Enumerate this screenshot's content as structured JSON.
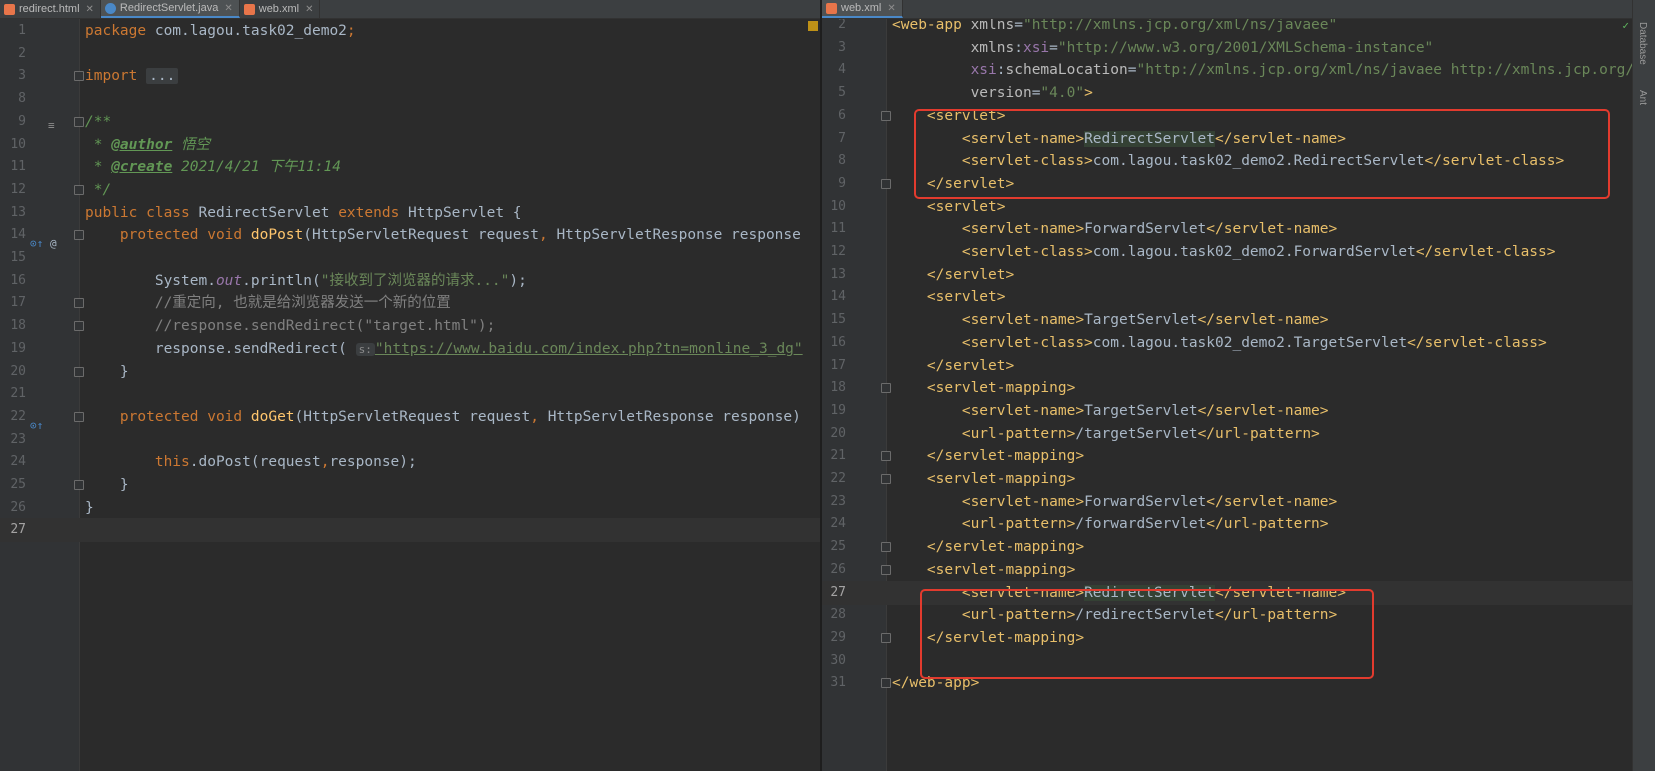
{
  "left_tabs": [
    {
      "label": "redirect.html",
      "icon": "html-file-icon",
      "color": "#e8754a"
    },
    {
      "label": "RedirectServlet.java",
      "icon": "java-class-icon",
      "color": "#4a88c7"
    },
    {
      "label": "web.xml",
      "icon": "xml-file-icon",
      "color": "#e8754a"
    }
  ],
  "right_tabs": [
    {
      "label": "web.xml",
      "icon": "xml-file-icon",
      "color": "#e8754a"
    }
  ],
  "right_strip_labels": [
    "Database",
    "Ant"
  ],
  "java_lines": [
    {
      "n": "1",
      "segs": [
        [
          "kw",
          "package "
        ],
        [
          "",
          "com.lagou.task02_demo2"
        ],
        [
          "kw",
          ";"
        ]
      ]
    },
    {
      "n": "2",
      "segs": []
    },
    {
      "n": "3",
      "segs": [
        [
          "kw",
          "import "
        ],
        [
          "fold-ell",
          "..."
        ]
      ]
    },
    {
      "n": "8",
      "segs": []
    },
    {
      "n": "9",
      "segs": [
        [
          "doc",
          "/**"
        ]
      ]
    },
    {
      "n": "10",
      "segs": [
        [
          "doc",
          " * "
        ],
        [
          "doctag",
          "@author"
        ],
        [
          "doc",
          " 悟空"
        ]
      ]
    },
    {
      "n": "11",
      "segs": [
        [
          "doc",
          " * "
        ],
        [
          "doctag",
          "@create"
        ],
        [
          "doc",
          " 2021/4/21 下午11:14"
        ]
      ]
    },
    {
      "n": "12",
      "segs": [
        [
          "doc",
          " */"
        ]
      ]
    },
    {
      "n": "13",
      "segs": [
        [
          "kw",
          "public class "
        ],
        [
          "",
          "RedirectServlet "
        ],
        [
          "kw",
          "extends "
        ],
        [
          "",
          "HttpServlet {"
        ]
      ]
    },
    {
      "n": "14",
      "segs": [
        [
          "",
          "    "
        ],
        [
          "kw",
          "protected void "
        ],
        [
          "method",
          "doPost"
        ],
        [
          "",
          "(HttpServletRequest request"
        ],
        [
          "kw",
          ", "
        ],
        [
          "",
          "HttpServletResponse response"
        ]
      ]
    },
    {
      "n": "15",
      "segs": []
    },
    {
      "n": "16",
      "segs": [
        [
          "",
          "        System."
        ],
        [
          "static",
          "out"
        ],
        [
          "",
          ".println("
        ],
        [
          "str",
          "\"接收到了浏览器的请求...\""
        ],
        [
          "",
          ");"
        ]
      ]
    },
    {
      "n": "17",
      "segs": [
        [
          "",
          "        "
        ],
        [
          "com",
          "//重定向, 也就是给浏览器发送一个新的位置"
        ]
      ]
    },
    {
      "n": "18",
      "segs": [
        [
          "",
          "        "
        ],
        [
          "com",
          "//response.sendRedirect(\"target.html\");"
        ]
      ]
    },
    {
      "n": "19",
      "segs": [
        [
          "",
          "        response.sendRedirect( "
        ],
        [
          "hint",
          "s:"
        ],
        [
          "",
          ""
        ],
        [
          "link",
          "\"https://www.baidu.com/index.php?tn=monline_3_dg\""
        ]
      ]
    },
    {
      "n": "20",
      "segs": [
        [
          "",
          "    }"
        ]
      ]
    },
    {
      "n": "21",
      "segs": []
    },
    {
      "n": "22",
      "segs": [
        [
          "",
          "    "
        ],
        [
          "kw",
          "protected void "
        ],
        [
          "method",
          "doGet"
        ],
        [
          "",
          "(HttpServletRequest request"
        ],
        [
          "kw",
          ", "
        ],
        [
          "",
          "HttpServletResponse response)"
        ]
      ]
    },
    {
      "n": "23",
      "segs": []
    },
    {
      "n": "24",
      "segs": [
        [
          "",
          "        "
        ],
        [
          "kw",
          "this"
        ],
        [
          "",
          ".doPost(request"
        ],
        [
          "kw",
          ","
        ],
        [
          "",
          "response);"
        ]
      ]
    },
    {
      "n": "25",
      "segs": [
        [
          "",
          "    }"
        ]
      ]
    },
    {
      "n": "26",
      "segs": [
        [
          "",
          "}"
        ]
      ]
    },
    {
      "n": "27",
      "segs": []
    }
  ],
  "xml_lines": [
    {
      "n": "2",
      "segs": [
        [
          "tag",
          "<web-app "
        ],
        [
          "attr",
          "xmlns"
        ],
        [
          "",
          "="
        ],
        [
          "str",
          "\"http://xmlns.jcp.org/xml/ns/javaee\""
        ]
      ]
    },
    {
      "n": "3",
      "segs": [
        [
          "",
          "         "
        ],
        [
          "attr",
          "xmlns"
        ],
        [
          "",
          ":"
        ],
        [
          "ns",
          "xsi"
        ],
        [
          "",
          "="
        ],
        [
          "str",
          "\"http://www.w3.org/2001/XMLSchema-instance\""
        ]
      ]
    },
    {
      "n": "4",
      "segs": [
        [
          "",
          "         "
        ],
        [
          "ns",
          "xsi"
        ],
        [
          "",
          ":"
        ],
        [
          "attr",
          "schemaLocation"
        ],
        [
          "",
          "="
        ],
        [
          "str",
          "\"http://xmlns.jcp.org/xml/ns/javaee http://xmlns.jcp.org/"
        ]
      ]
    },
    {
      "n": "5",
      "segs": [
        [
          "",
          "         "
        ],
        [
          "attr",
          "version"
        ],
        [
          "",
          "="
        ],
        [
          "str",
          "\"4.0\""
        ],
        [
          "tag",
          ">"
        ]
      ]
    },
    {
      "n": "6",
      "segs": [
        [
          "",
          "    "
        ],
        [
          "tag",
          "<servlet>"
        ]
      ]
    },
    {
      "n": "7",
      "segs": [
        [
          "",
          "        "
        ],
        [
          "tag",
          "<servlet-name>"
        ],
        [
          "hl",
          "RedirectServlet"
        ],
        [
          "tag",
          "</servlet-name>"
        ]
      ]
    },
    {
      "n": "8",
      "segs": [
        [
          "",
          "        "
        ],
        [
          "tag",
          "<servlet-class>"
        ],
        [
          "",
          "com.lagou.task02_demo2.RedirectServlet"
        ],
        [
          "tag",
          "</servlet-class>"
        ]
      ]
    },
    {
      "n": "9",
      "segs": [
        [
          "",
          "    "
        ],
        [
          "tag",
          "</servlet>"
        ]
      ]
    },
    {
      "n": "10",
      "segs": [
        [
          "",
          "    "
        ],
        [
          "tag",
          "<servlet>"
        ]
      ]
    },
    {
      "n": "11",
      "segs": [
        [
          "",
          "        "
        ],
        [
          "tag",
          "<servlet-name>"
        ],
        [
          "",
          "ForwardServlet"
        ],
        [
          "tag",
          "</servlet-name>"
        ]
      ]
    },
    {
      "n": "12",
      "segs": [
        [
          "",
          "        "
        ],
        [
          "tag",
          "<servlet-class>"
        ],
        [
          "",
          "com.lagou.task02_demo2.ForwardServlet"
        ],
        [
          "tag",
          "</servlet-class>"
        ]
      ]
    },
    {
      "n": "13",
      "segs": [
        [
          "",
          "    "
        ],
        [
          "tag",
          "</servlet>"
        ]
      ]
    },
    {
      "n": "14",
      "segs": [
        [
          "",
          "    "
        ],
        [
          "tag",
          "<servlet>"
        ]
      ]
    },
    {
      "n": "15",
      "segs": [
        [
          "",
          "        "
        ],
        [
          "tag",
          "<servlet-name>"
        ],
        [
          "",
          "TargetServlet"
        ],
        [
          "tag",
          "</servlet-name>"
        ]
      ]
    },
    {
      "n": "16",
      "segs": [
        [
          "",
          "        "
        ],
        [
          "tag",
          "<servlet-class>"
        ],
        [
          "",
          "com.lagou.task02_demo2.TargetServlet"
        ],
        [
          "tag",
          "</servlet-class>"
        ]
      ]
    },
    {
      "n": "17",
      "segs": [
        [
          "",
          "    "
        ],
        [
          "tag",
          "</servlet>"
        ]
      ]
    },
    {
      "n": "18",
      "segs": [
        [
          "",
          "    "
        ],
        [
          "tag",
          "<servlet-mapping>"
        ]
      ]
    },
    {
      "n": "19",
      "segs": [
        [
          "",
          "        "
        ],
        [
          "tag",
          "<servlet-name>"
        ],
        [
          "",
          "TargetServlet"
        ],
        [
          "tag",
          "</servlet-name>"
        ]
      ]
    },
    {
      "n": "20",
      "segs": [
        [
          "",
          "        "
        ],
        [
          "tag",
          "<url-pattern>"
        ],
        [
          "",
          "/targetServlet"
        ],
        [
          "tag",
          "</url-pattern>"
        ]
      ]
    },
    {
      "n": "21",
      "segs": [
        [
          "",
          "    "
        ],
        [
          "tag",
          "</servlet-mapping>"
        ]
      ]
    },
    {
      "n": "22",
      "segs": [
        [
          "",
          "    "
        ],
        [
          "tag",
          "<servlet-mapping>"
        ]
      ]
    },
    {
      "n": "23",
      "segs": [
        [
          "",
          "        "
        ],
        [
          "tag",
          "<servlet-name>"
        ],
        [
          "",
          "ForwardServlet"
        ],
        [
          "tag",
          "</servlet-name>"
        ]
      ]
    },
    {
      "n": "24",
      "segs": [
        [
          "",
          "        "
        ],
        [
          "tag",
          "<url-pattern>"
        ],
        [
          "",
          "/forwardServlet"
        ],
        [
          "tag",
          "</url-pattern>"
        ]
      ]
    },
    {
      "n": "25",
      "segs": [
        [
          "",
          "    "
        ],
        [
          "tag",
          "</servlet-mapping>"
        ]
      ]
    },
    {
      "n": "26",
      "segs": [
        [
          "",
          "    "
        ],
        [
          "tag",
          "<servlet-mapping>"
        ]
      ]
    },
    {
      "n": "27",
      "segs": [
        [
          "",
          "        "
        ],
        [
          "tag",
          "<servlet-name>"
        ],
        [
          "hl",
          "RedirectServlet"
        ],
        [
          "tag",
          "</servlet-name>"
        ]
      ]
    },
    {
      "n": "28",
      "segs": [
        [
          "",
          "        "
        ],
        [
          "tag",
          "<url-pattern>"
        ],
        [
          "",
          "/redirectServlet"
        ],
        [
          "tag",
          "</url-pattern>"
        ]
      ]
    },
    {
      "n": "29",
      "segs": [
        [
          "",
          "    "
        ],
        [
          "tag",
          "</servlet-mapping>"
        ]
      ]
    },
    {
      "n": "30",
      "segs": []
    },
    {
      "n": "31",
      "segs": [
        [
          "tag",
          "</web-app>"
        ]
      ]
    }
  ]
}
